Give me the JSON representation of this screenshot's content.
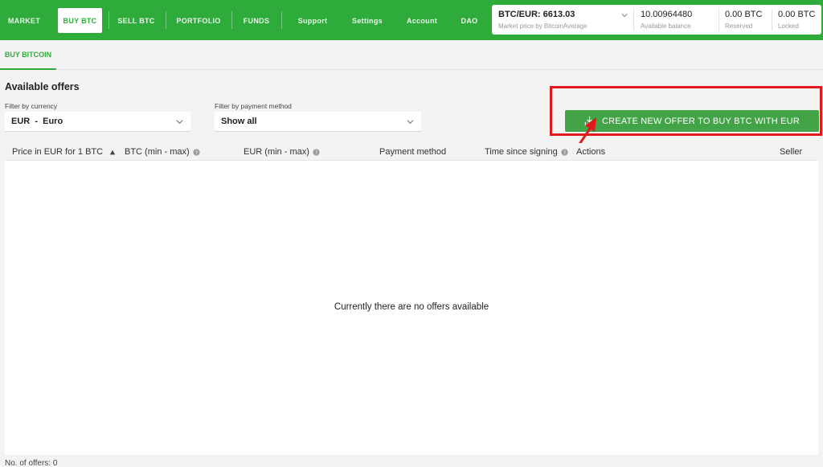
{
  "nav": {
    "items": [
      {
        "label": "MARKET"
      },
      {
        "label": "BUY BTC"
      },
      {
        "label": "SELL BTC"
      },
      {
        "label": "PORTFOLIO"
      },
      {
        "label": "FUNDS"
      },
      {
        "label": "Support"
      },
      {
        "label": "Settings"
      },
      {
        "label": "Account"
      },
      {
        "label": "DAO"
      }
    ],
    "active": "BUY BTC"
  },
  "balances": {
    "price": {
      "value": "BTC/EUR: 6613.03",
      "sub": "Market price by BitcoinAverage"
    },
    "available": {
      "value": "10.00964480",
      "sub": "Available balance"
    },
    "reserved": {
      "value": "0.00 BTC",
      "sub": "Reserved"
    },
    "locked": {
      "value": "0.00 BTC",
      "sub": "Locked"
    }
  },
  "subtab": {
    "label": "BUY BITCOIN"
  },
  "offers": {
    "title": "Available offers",
    "filter_currency": {
      "label": "Filter by currency",
      "value": "EUR  -  Euro"
    },
    "filter_payment": {
      "label": "Filter by payment method",
      "value": "Show all"
    },
    "create_button": "CREATE NEW OFFER TO BUY BTC WITH EUR",
    "columns": [
      "Price in EUR for 1 BTC",
      "BTC (min - max)",
      "EUR (min - max)",
      "Payment method",
      "Time since signing",
      "Actions",
      "Seller"
    ],
    "empty_message": "Currently there are no offers available",
    "count_label": "No. of offers: 0"
  },
  "colors": {
    "brand_green": "#2fab3c",
    "button_green": "#43a447",
    "highlight_red": "#e0191d"
  },
  "icons": {
    "currency_chevron": "chevron-down-icon",
    "create_offer": "download-tray-icon",
    "sort": "sort-asc-icon",
    "help": "question-circle-icon"
  }
}
